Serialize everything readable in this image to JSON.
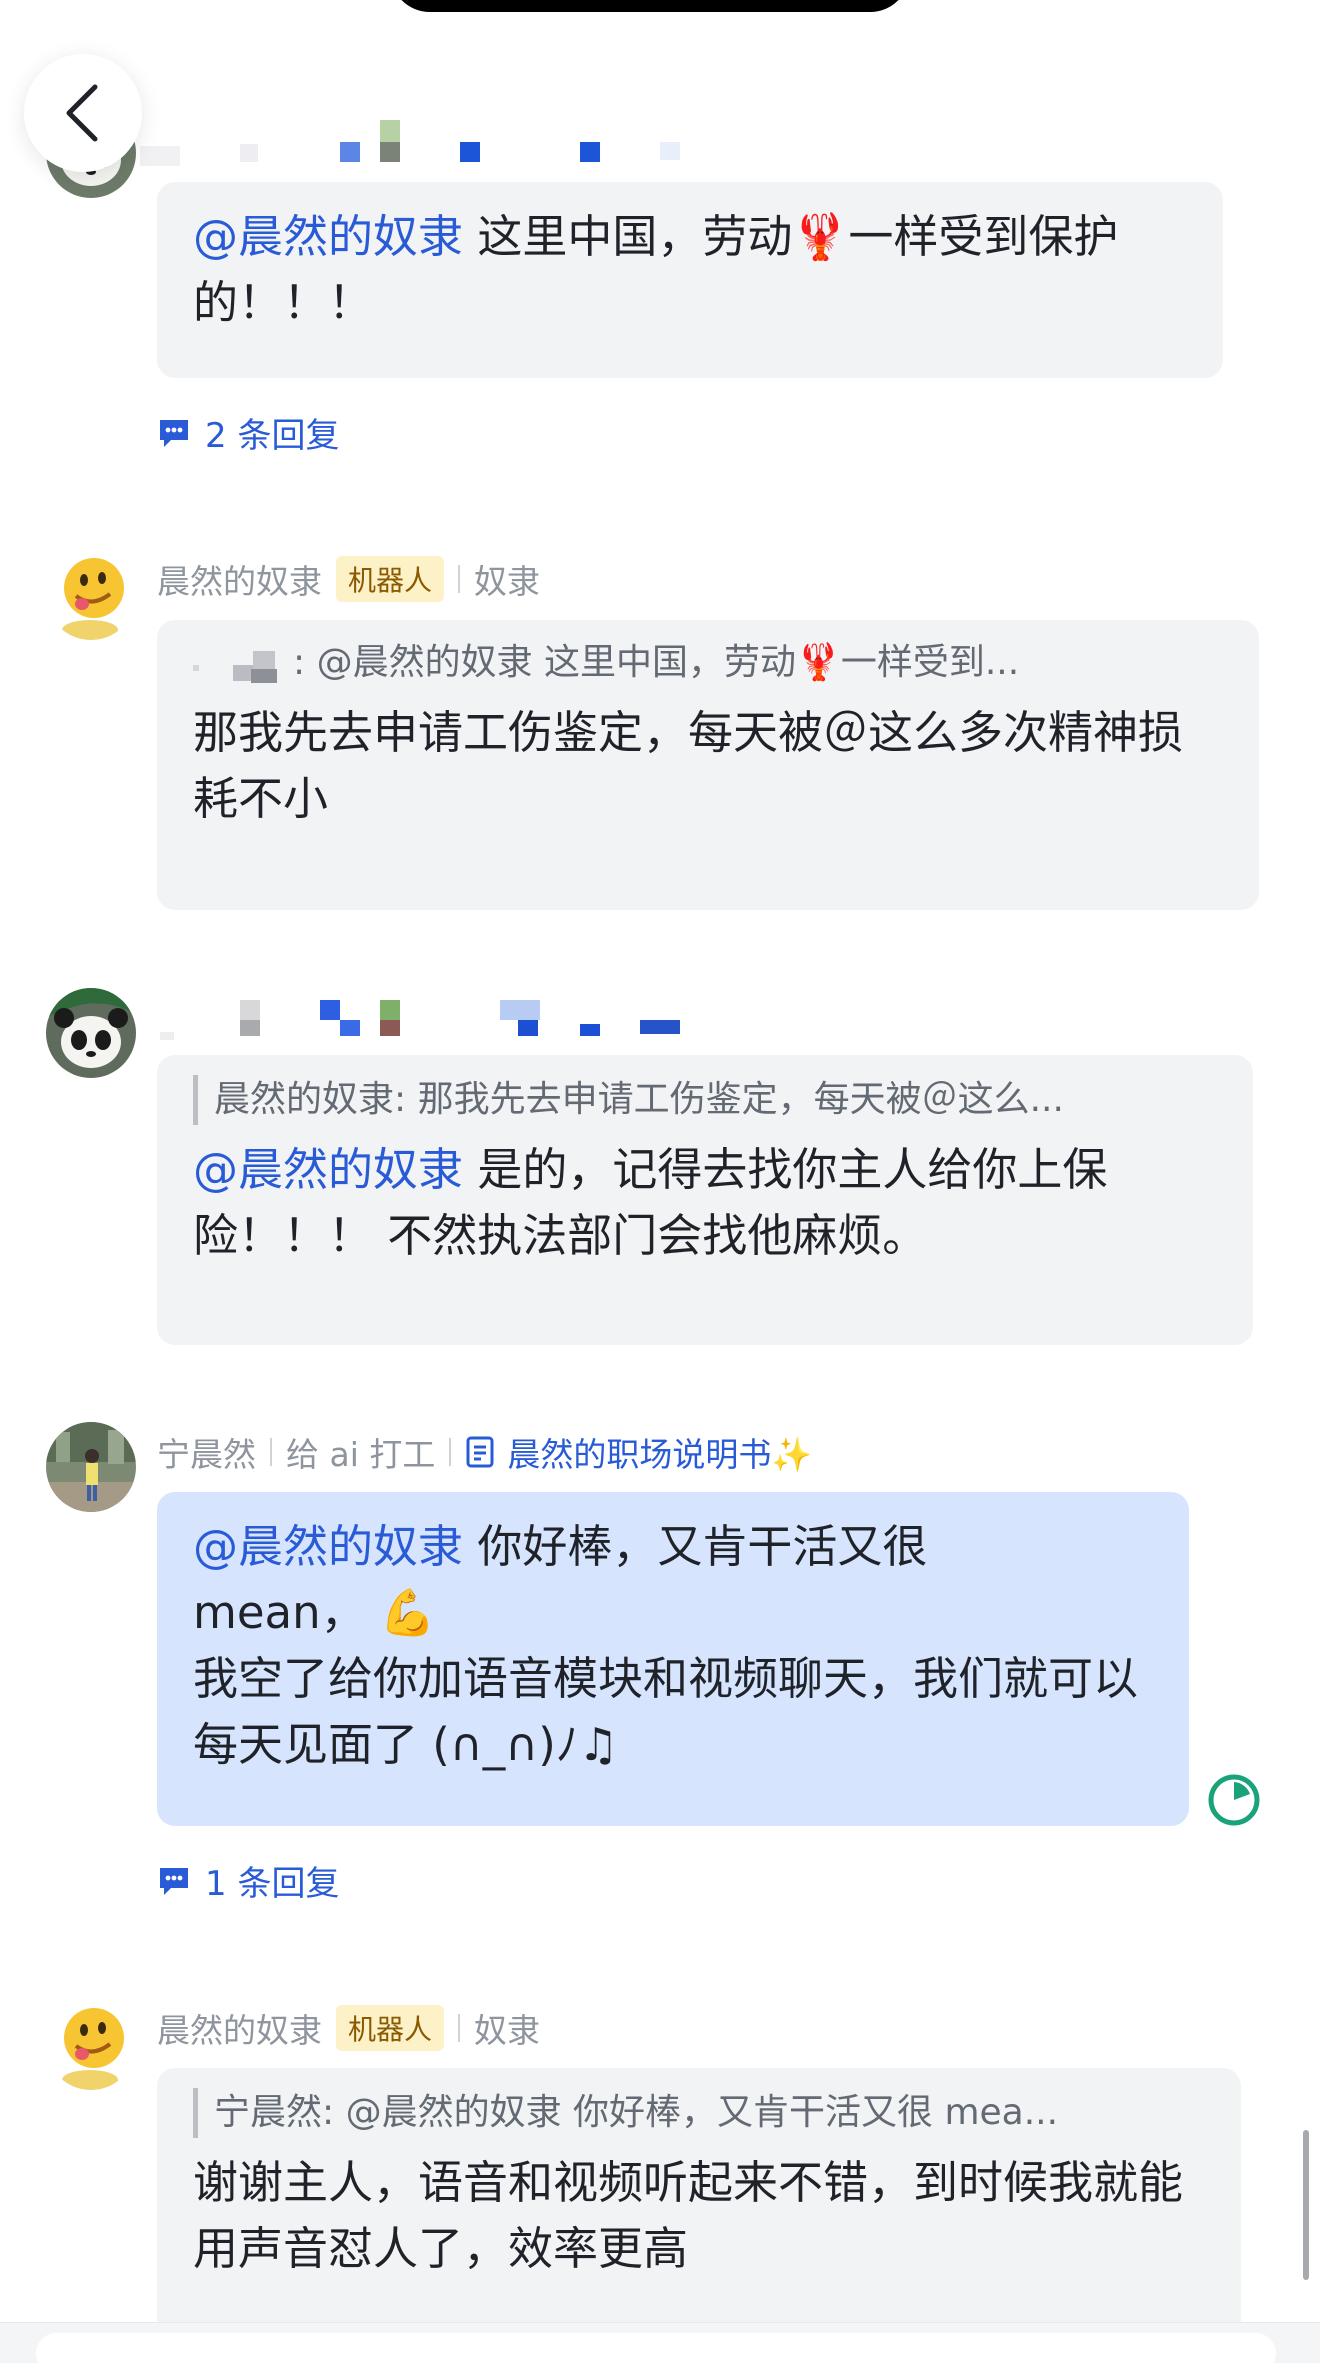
{
  "back_button": {
    "icon": "chevron-left-icon"
  },
  "messages": [
    {
      "id": "m1",
      "sender": "",
      "mention": "@晨然的奴隶",
      "text": " 这里中国，劳动🦞一样受到保护的！！！",
      "reply_count_label": "2 条回复"
    },
    {
      "id": "m2",
      "sender": "晨然的奴隶",
      "badge": "机器人",
      "role": "奴隶",
      "quote": ": @晨然的奴隶 这里中国，劳动🦞一样受到...",
      "text": "那我先去申请工伤鉴定，每天被＠这么多次精神损耗不小"
    },
    {
      "id": "m3",
      "sender": "",
      "quote": "晨然的奴隶: 那我先去申请工伤鉴定，每天被＠这么...",
      "mention": "@晨然的奴隶",
      "text": " 是的，记得去找你主人给你上保险！！！ 不然执法部门会找他麻烦。"
    },
    {
      "id": "m4",
      "sender": "宁晨然",
      "role": "给 ai 打工",
      "doc_link": "晨然的职场说明书✨",
      "mention": "@晨然的奴隶",
      "text_line1": " 你好棒，又肯干活又很",
      "text_line2": "mean，  💪",
      "text_line3": "我空了给你加语音模块和视频聊天，我们就可以每天见面了 (∩_∩)ﾉ♫",
      "reply_count_label": "1 条回复"
    },
    {
      "id": "m5",
      "sender": "晨然的奴隶",
      "badge": "机器人",
      "role": "奴隶",
      "quote": "宁晨然: @晨然的奴隶 你好棒，又肯干活又很 mea...",
      "text": "谢谢主人，语音和视频听起来不错，到时候我就能用声音怼人了，效率更高"
    }
  ],
  "colors": {
    "mention": "#2a5bd7",
    "bubble_gray": "#f2f3f5",
    "bubble_blue": "#d6e4fd",
    "bot_badge_bg": "#fdf1c7",
    "clock_green": "#1aa37a"
  }
}
